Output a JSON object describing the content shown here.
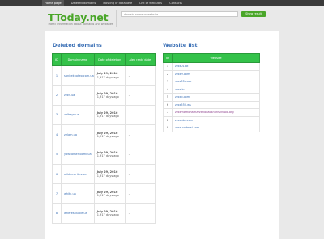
{
  "nav": {
    "items": [
      "Home page",
      "Deleted domains",
      "Hosting IP database",
      "List of websites",
      "Contacts"
    ]
  },
  "header": {
    "logo": "TToday.net",
    "tagline": "Traffic information about domains and websites",
    "search_placeholder": "domain name or website...",
    "search_button": "Show result"
  },
  "deleted": {
    "title": "Deleted domains",
    "columns": [
      "ID",
      "Domain name",
      "Date of deletion",
      "Alex rank/ date"
    ],
    "rows": [
      {
        "id": "1",
        "domain": "sanitekhoteo.com.ua",
        "date": "July 29, 2016",
        "ago": "1,917 days ago",
        "rank": "-"
      },
      {
        "id": "2",
        "domain": "zzzit.ua",
        "date": "July 29, 2016",
        "ago": "1,917 days ago",
        "rank": "-"
      },
      {
        "id": "3",
        "domain": "zelbeys.ua",
        "date": "July 29, 2016",
        "ago": "1,917 days ago",
        "rank": "-"
      },
      {
        "id": "4",
        "domain": "zelam.ua",
        "date": "July 29, 2016",
        "ago": "1,917 days ago",
        "rank": "-"
      },
      {
        "id": "5",
        "domain": "yowcomertoomi.ua",
        "date": "July 29, 2016",
        "ago": "1,917 days ago",
        "rank": "-"
      },
      {
        "id": "6",
        "domain": "wildnewrites.ua",
        "date": "July 29, 2016",
        "ago": "1,917 days ago",
        "rank": "-"
      },
      {
        "id": "7",
        "domain": "whitc.ua",
        "date": "July 29, 2016",
        "ago": "1,917 days ago",
        "rank": "-"
      },
      {
        "id": "8",
        "domain": "wheresoluble.ua",
        "date": "July 29, 2016",
        "ago": "1,917 days ago",
        "rank": "-"
      }
    ]
  },
  "websites": {
    "title": "Website list",
    "columns": [
      "ID",
      "Website"
    ],
    "rows": [
      {
        "id": "1",
        "site": "zzzz01.at"
      },
      {
        "id": "2",
        "site": "zzzzff.com"
      },
      {
        "id": "3",
        "site": "zzzz35.com"
      },
      {
        "id": "4",
        "site": "zzzz.in"
      },
      {
        "id": "5",
        "site": "zzzzb.com"
      },
      {
        "id": "6",
        "site": "zzzz550.ws"
      },
      {
        "id": "7",
        "site": "zzzzmomohamzzzanooaosnonsnnnoo.org"
      },
      {
        "id": "8",
        "site": "zzzzubs.com"
      },
      {
        "id": "9",
        "site": "zzzzuvotmai.com"
      }
    ]
  }
}
